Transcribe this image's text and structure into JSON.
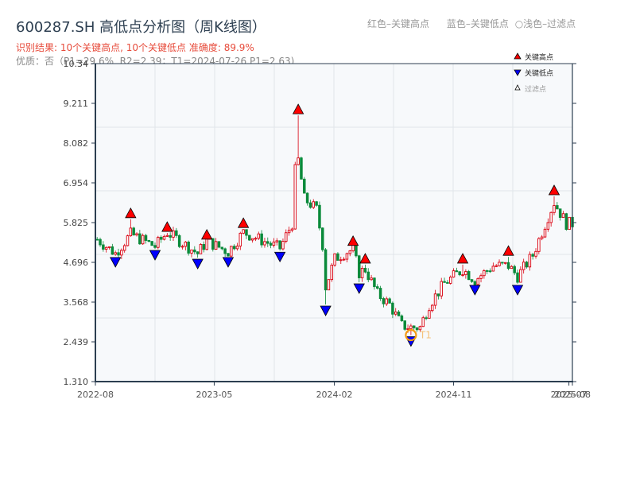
{
  "header": {
    "title": "600287.SH 高低点分析图（周K线图）",
    "result": "识别结果: 10个关键高点, 10个关键低点   准确度: 89.9%",
    "quality": "优质：否（P1=29.6%, R2=2.39；T1=2024-07-26 P1=2.63)",
    "hint_high": "红色–关键高点",
    "hint_low": "蓝色–关键低点",
    "hint_filtered": "○浅色–过滤点"
  },
  "chart_data": {
    "type": "candlestick",
    "title": "600287.SH 高低点分析图（周K线图）",
    "ylim": [
      1.31,
      10.34
    ],
    "y_ticks": [
      "1.310",
      "2.439",
      "3.568",
      "4.696",
      "5.825",
      "6.954",
      "8.082",
      "9.211",
      "10.34"
    ],
    "x_range": [
      "2022-08-01",
      "2025-08-01"
    ],
    "x_ticks": [
      {
        "label": "2022-08",
        "date": "2022-08-01"
      },
      {
        "label": "2023-05",
        "date": "2023-05-01"
      },
      {
        "label": "2024-02",
        "date": "2024-02-01"
      },
      {
        "label": "2024-11",
        "date": "2024-11-01"
      },
      {
        "label": "2025-07",
        "date": "2025-07-24"
      },
      {
        "label": "2025-08",
        "date": "2025-08-01"
      }
    ],
    "grid": true,
    "colors": {
      "up": "#d9000f",
      "down": "#0a8a3a",
      "high_marker": "#ff0000",
      "low_marker": "#0000ff",
      "t1_circle": "#f39c12",
      "plot_bg": "#f7f9fb",
      "axis": "#2c3e50"
    },
    "price_path": [
      [
        "2022-08-05",
        5.35
      ],
      [
        "2022-09-16",
        4.95
      ],
      [
        "2022-10-21",
        5.5
      ],
      [
        "2022-12-16",
        5.15
      ],
      [
        "2023-01-13",
        5.55
      ],
      [
        "2023-03-24",
        4.95
      ],
      [
        "2023-04-14",
        5.3
      ],
      [
        "2023-06-02",
        5.0
      ],
      [
        "2023-07-07",
        5.55
      ],
      [
        "2023-09-29",
        5.1
      ],
      [
        "2023-10-27",
        5.8
      ],
      [
        "2023-11-03",
        7.3
      ],
      [
        "2023-11-10",
        7.6
      ],
      [
        "2023-11-24",
        6.5
      ],
      [
        "2023-12-22",
        6.2
      ],
      [
        "2024-01-05",
        5.2
      ],
      [
        "2024-01-12",
        4.0
      ],
      [
        "2024-02-02",
        4.8
      ],
      [
        "2024-03-01",
        5.0
      ],
      [
        "2024-03-15",
        5.05
      ],
      [
        "2024-03-29",
        4.4
      ],
      [
        "2024-04-12",
        4.5
      ],
      [
        "2024-05-10",
        3.8
      ],
      [
        "2024-06-07",
        3.5
      ],
      [
        "2024-07-05",
        2.9
      ],
      [
        "2024-07-26",
        2.85
      ],
      [
        "2024-08-16",
        2.85
      ],
      [
        "2024-09-06",
        3.5
      ],
      [
        "2024-10-11",
        4.1
      ],
      [
        "2024-11-22",
        4.5
      ],
      [
        "2024-12-20",
        4.2
      ],
      [
        "2025-01-31",
        4.6
      ],
      [
        "2025-03-07",
        4.6
      ],
      [
        "2025-03-28",
        4.3
      ],
      [
        "2025-05-02",
        4.9
      ],
      [
        "2025-06-06",
        6.0
      ],
      [
        "2025-06-20",
        6.4
      ],
      [
        "2025-07-18",
        5.8
      ],
      [
        "2025-08-01",
        5.8
      ]
    ],
    "key_highs": [
      {
        "date": "2022-10-21",
        "price": 5.92
      },
      {
        "date": "2023-01-13",
        "price": 5.53
      },
      {
        "date": "2023-04-14",
        "price": 5.31
      },
      {
        "date": "2023-07-07",
        "price": 5.64
      },
      {
        "date": "2023-11-10",
        "price": 8.87
      },
      {
        "date": "2024-03-15",
        "price": 5.13
      },
      {
        "date": "2024-04-12",
        "price": 4.63
      },
      {
        "date": "2024-11-22",
        "price": 4.63
      },
      {
        "date": "2025-03-07",
        "price": 4.85
      },
      {
        "date": "2025-06-20",
        "price": 6.57
      }
    ],
    "key_lows": [
      {
        "date": "2022-09-16",
        "price": 4.88
      },
      {
        "date": "2022-12-16",
        "price": 5.08
      },
      {
        "date": "2023-03-24",
        "price": 4.83
      },
      {
        "date": "2023-06-02",
        "price": 4.88
      },
      {
        "date": "2023-09-29",
        "price": 5.03
      },
      {
        "date": "2024-01-12",
        "price": 3.5
      },
      {
        "date": "2024-03-29",
        "price": 4.13
      },
      {
        "date": "2024-07-26",
        "price": 2.63
      },
      {
        "date": "2024-12-20",
        "price": 4.09
      },
      {
        "date": "2025-03-28",
        "price": 4.09
      }
    ],
    "t1": {
      "label": "T1",
      "date": "2024-07-26",
      "price": 2.63
    },
    "legend": {
      "position": "top-right",
      "items": [
        {
          "label": "关键高点",
          "marker": "triangle-up-red"
        },
        {
          "label": "关键低点",
          "marker": "triangle-down-blue"
        },
        {
          "label": "过滤点",
          "marker": "triangle-up-white"
        }
      ]
    }
  }
}
